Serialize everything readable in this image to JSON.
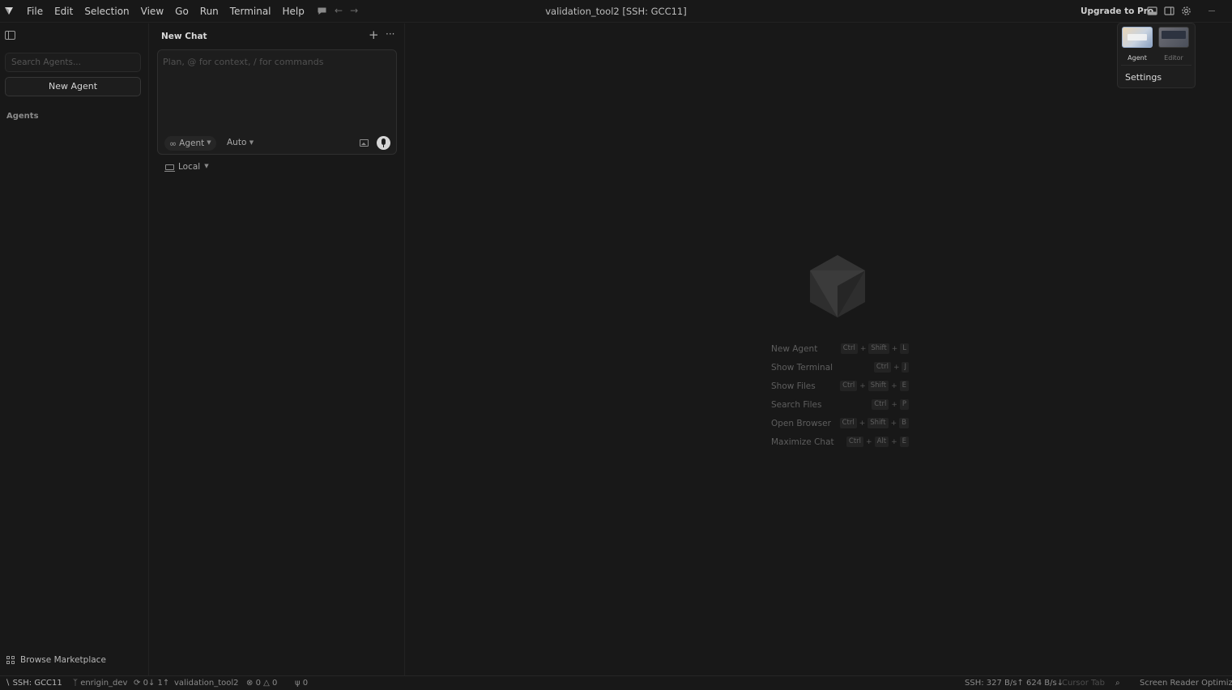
{
  "titlebar": {
    "menu": [
      "File",
      "Edit",
      "Selection",
      "View",
      "Go",
      "Run",
      "Terminal",
      "Help"
    ],
    "window_title": "validation_tool2 [SSH: GCC11]",
    "upgrade_label": "Upgrade to Pro"
  },
  "sidebar": {
    "search_placeholder": "Search Agents...",
    "new_agent_label": "New Agent",
    "section_label": "Agents",
    "marketplace_label": "Browse Marketplace"
  },
  "chat": {
    "title": "New Chat",
    "input_placeholder": "Plan, @ for context, / for commands",
    "mode_label": "Agent",
    "model_label": "Auto",
    "environment_label": "Local"
  },
  "shortcuts": [
    {
      "label": "New Agent",
      "keys": [
        "Ctrl",
        "Shift",
        "L"
      ]
    },
    {
      "label": "Show Terminal",
      "keys": [
        "Ctrl",
        "J"
      ]
    },
    {
      "label": "Show Files",
      "keys": [
        "Ctrl",
        "Shift",
        "E"
      ]
    },
    {
      "label": "Search Files",
      "keys": [
        "Ctrl",
        "P"
      ]
    },
    {
      "label": "Open Browser",
      "keys": [
        "Ctrl",
        "Shift",
        "B"
      ]
    },
    {
      "label": "Maximize Chat",
      "keys": [
        "Ctrl",
        "Alt",
        "E"
      ]
    }
  ],
  "popover": {
    "agent_label": "Agent",
    "editor_label": "Editor",
    "settings_label": "Settings"
  },
  "statusbar": {
    "remote": "SSH: GCC11",
    "branch": "enrigin_dev",
    "sync": "0↓ 1↑",
    "folder": "validation_tool2",
    "errors": "0",
    "warnings": "0",
    "ports": "0",
    "ssh_traffic": "SSH: 327 B/s↑ 624 B/s↓",
    "cursor_tab": "Cursor Tab",
    "screen_reader": "Screen Reader Optimized"
  },
  "colors": {
    "background": "#181818",
    "panel_border": "#222222",
    "text_primary": "#cccccc",
    "text_muted": "#5e5e5e"
  }
}
